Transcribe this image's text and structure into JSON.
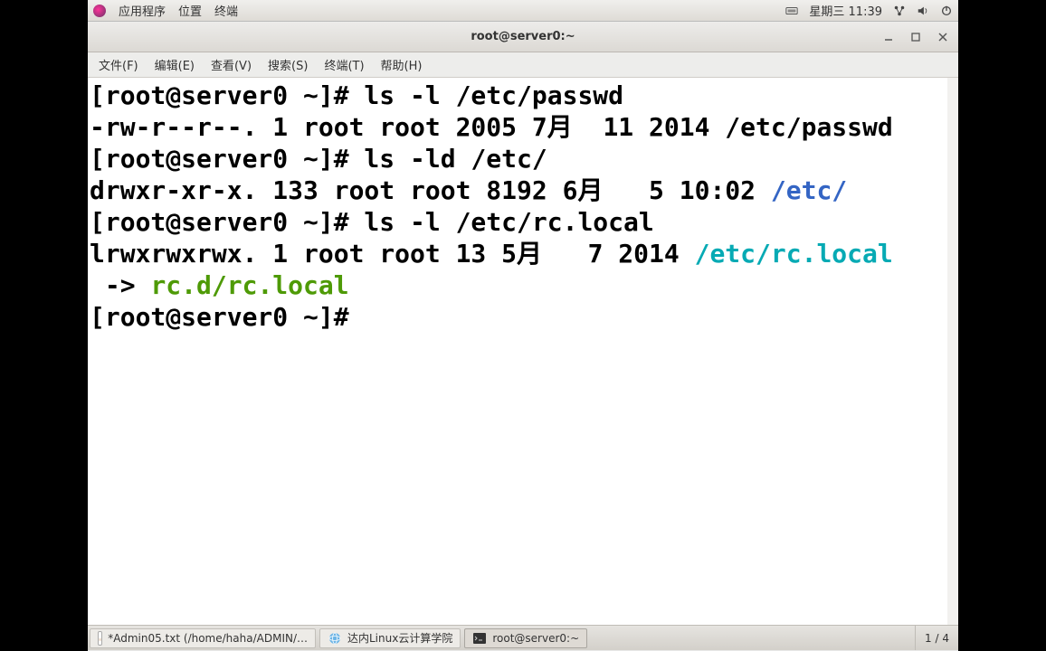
{
  "topbar": {
    "apps": "应用程序",
    "places": "位置",
    "terminal": "终端",
    "datetime": "星期三 11:39"
  },
  "window": {
    "title": "root@server0:~"
  },
  "menus": {
    "file": "文件(F)",
    "edit": "编辑(E)",
    "view": "查看(V)",
    "search": "搜索(S)",
    "terminal": "终端(T)",
    "help": "帮助(H)"
  },
  "term": {
    "l1": "[root@server0 ~]# ls -l /etc/passwd",
    "l2": "-rw-r--r--. 1 root root 2005 7月  11 2014 /etc/passwd",
    "l3": "[root@server0 ~]# ls -ld /etc/",
    "l4a": "drwxr-xr-x. 133 root root 8192 6月   5 10:02 ",
    "l4b": "/etc/",
    "l5": "[root@server0 ~]# ls -l /etc/rc.local",
    "l6a": "lrwxrwxrwx. 1 root root 13 5月   7 2014 ",
    "l6b": "/etc/rc.local",
    "l7a": " -> ",
    "l7b": "rc.d/rc.local",
    "l8": "[root@server0 ~]# "
  },
  "taskbar": {
    "t1": "*Admin05.txt (/home/haha/ADMIN/…",
    "t2": "达内Linux云计算学院",
    "t3": "root@server0:~",
    "pager": "1 / 4"
  }
}
